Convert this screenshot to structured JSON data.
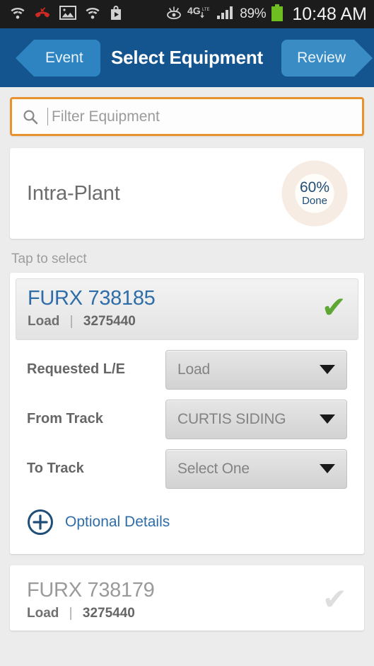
{
  "status_bar": {
    "icons": [
      "wifi-question-icon",
      "missed-call-icon",
      "gallery-icon",
      "wifi-question-icon",
      "play-store-icon",
      "smart-stay-eye-icon",
      "4g-lte-icon",
      "signal-bars-icon"
    ],
    "battery_percent": "89%",
    "clock": "10:48 AM"
  },
  "navbar": {
    "prev_label": "Event",
    "title": "Select Equipment",
    "next_label": "Review"
  },
  "search": {
    "placeholder": "Filter Equipment",
    "value": "",
    "icon": "search-icon",
    "focus_color": "#e8922e"
  },
  "group": {
    "title": "Intra-Plant",
    "progress_percent": "60%",
    "progress_caption": "Done",
    "progress_value": 60,
    "progress_color": "#63a833",
    "track_color": "#f6ece3"
  },
  "hint": "Tap to select",
  "equipment": [
    {
      "id": "FURX 738185",
      "load_label": "Load",
      "separator": "|",
      "number": "3275440",
      "selected": true,
      "check_icon": "check-icon"
    },
    {
      "id": "FURX 738179",
      "load_label": "Load",
      "separator": "|",
      "number": "3275440",
      "selected": false,
      "check_icon": "check-icon"
    }
  ],
  "form": {
    "rows": [
      {
        "label": "Requested L/E",
        "value": "Load"
      },
      {
        "label": "From Track",
        "value": "CURTIS SIDING"
      },
      {
        "label": "To Track",
        "value": "Select One"
      }
    ],
    "optional_details_label": "Optional Details",
    "optional_details_icon": "plus-circle-icon"
  }
}
